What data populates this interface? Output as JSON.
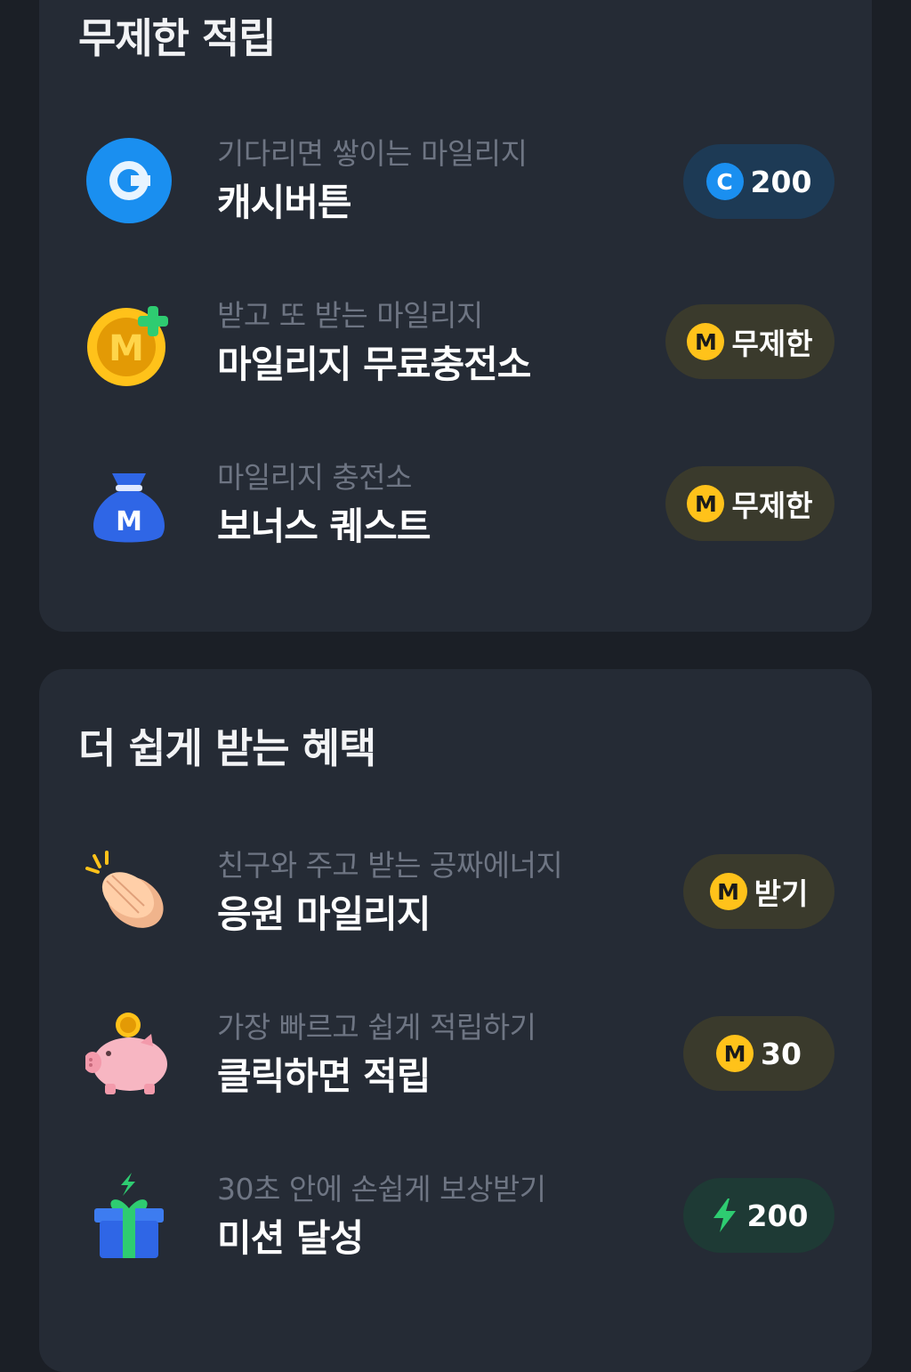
{
  "sections": [
    {
      "title": "무제한 적립",
      "items": [
        {
          "subtitle": "기다리면 쌓이는 마일리지",
          "title": "캐시버튼",
          "icon": "cash-button-icon",
          "reward_icon": "cash-coin-icon",
          "reward": "200"
        },
        {
          "subtitle": "받고 또 받는 마일리지",
          "title": "마일리지 무료충전소",
          "icon": "mileage-coin-plus-icon",
          "reward_icon": "mileage-coin-icon",
          "reward": "무제한"
        },
        {
          "subtitle": "마일리지 충전소",
          "title": "보너스 퀘스트",
          "icon": "money-bag-icon",
          "reward_icon": "mileage-coin-icon",
          "reward": "무제한"
        }
      ]
    },
    {
      "title": "더 쉽게 받는 혜택",
      "items": [
        {
          "subtitle": "친구와 주고 받는 공짜에너지",
          "title": "응원 마일리지",
          "icon": "clapping-hands-icon",
          "reward_icon": "mileage-coin-icon",
          "reward": "받기"
        },
        {
          "subtitle": "가장 빠르고 쉽게 적립하기",
          "title": "클릭하면 적립",
          "icon": "piggy-bank-icon",
          "reward_icon": "mileage-coin-icon",
          "reward": "30"
        },
        {
          "subtitle": "30초 안에 손쉽게 보상받기",
          "title": "미션 달성",
          "icon": "gift-box-icon",
          "reward_icon": "lightning-bolt-icon",
          "reward": "200"
        }
      ]
    }
  ],
  "coin_letters": {
    "cash": "C",
    "mileage": "M"
  },
  "colors": {
    "background": "#1b1f26",
    "card": "#252b35",
    "cash_blue": "#1a8ff0",
    "mileage_gold": "#ffc21a",
    "energy_green": "#2ecc71"
  }
}
